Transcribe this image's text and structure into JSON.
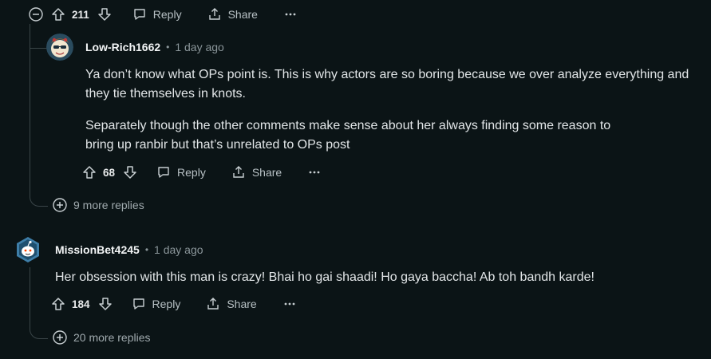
{
  "top_actions": {
    "votes": "211",
    "reply": "Reply",
    "share": "Share"
  },
  "comment1": {
    "username": "Low-Rich1662",
    "separator": "•",
    "time": "1 day ago",
    "paragraph1": "Ya don’t know what OPs point is. This is why actors are so boring because we over analyze everything and they tie themselves in knots.",
    "paragraph2": "Separately though the other comments make sense about her always finding some reason to bring up ranbir but that’s unrelated to OPs post",
    "votes": "68",
    "reply": "Reply",
    "share": "Share"
  },
  "more_replies_1": "9 more replies",
  "comment2": {
    "username": "MissionBet4245",
    "separator": "•",
    "time": "1 day ago",
    "body": "Her obsession with this man is crazy! Bhai ho gai shaadi! Ho gaya baccha! Ab toh bandh karde!",
    "votes": "184",
    "reply": "Reply",
    "share": "Share"
  },
  "more_replies_2": "20 more replies"
}
